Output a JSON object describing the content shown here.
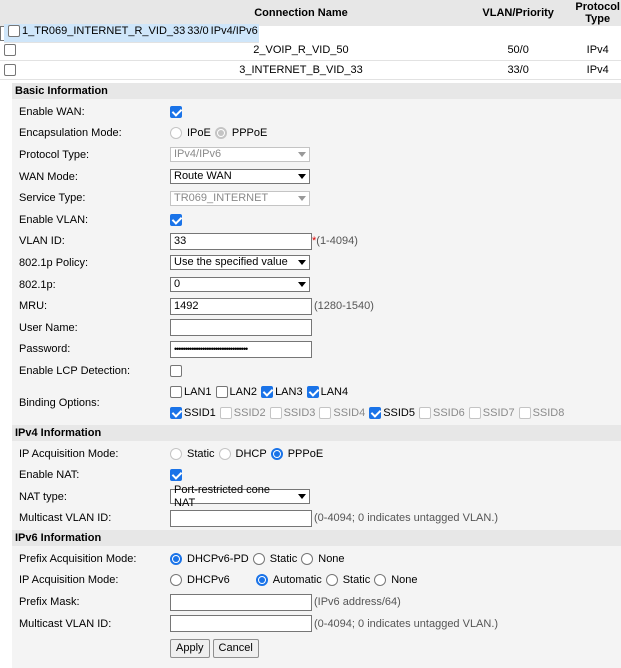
{
  "connections": {
    "headers": [
      "",
      "Connection Name",
      "VLAN/Priority",
      "Protocol Type"
    ],
    "rows": [
      {
        "name": "1_TR069_INTERNET_R_VID_33",
        "vlan": "33/0",
        "protocol": "IPv4/IPv6",
        "selected": true
      },
      {
        "name": "2_VOIP_R_VID_50",
        "vlan": "50/0",
        "protocol": "IPv4",
        "selected": false
      },
      {
        "name": "3_INTERNET_B_VID_33",
        "vlan": "33/0",
        "protocol": "IPv4",
        "selected": false
      }
    ]
  },
  "basic": {
    "title": "Basic Information",
    "enable_wan_label": "Enable WAN:",
    "encap_label": "Encapsulation Mode:",
    "encap_ipoe": "IPoE",
    "encap_pppoe": "PPPoE",
    "protocol_type_label": "Protocol Type:",
    "protocol_type_value": "IPv4/IPv6",
    "wan_mode_label": "WAN Mode:",
    "wan_mode_value": "Route WAN",
    "service_type_label": "Service Type:",
    "service_type_value": "TR069_INTERNET",
    "enable_vlan_label": "Enable VLAN:",
    "vlan_id_label": "VLAN ID:",
    "vlan_id_value": "33",
    "vlan_id_req": "*",
    "vlan_id_hint": "(1-4094)",
    "policy_label": "802.1p Policy:",
    "policy_value": "Use the specified value",
    "p_label": "802.1p:",
    "p_value": "0",
    "mru_label": "MRU:",
    "mru_value": "1492",
    "mru_hint": "(1280-1540)",
    "username_label": "User Name:",
    "username_value": "",
    "password_label": "Password:",
    "password_value": "••••••••••••••••••••••••••••••••••",
    "lcp_label": "Enable LCP Detection:",
    "binding_label": "Binding Options:",
    "lan": [
      {
        "label": "LAN1",
        "checked": false
      },
      {
        "label": "LAN2",
        "checked": false
      },
      {
        "label": "LAN3",
        "checked": true
      },
      {
        "label": "LAN4",
        "checked": true
      }
    ],
    "ssid": [
      {
        "label": "SSID1",
        "checked": true,
        "disabled": false
      },
      {
        "label": "SSID2",
        "checked": false,
        "disabled": true
      },
      {
        "label": "SSID3",
        "checked": false,
        "disabled": true
      },
      {
        "label": "SSID4",
        "checked": false,
        "disabled": true
      },
      {
        "label": "SSID5",
        "checked": true,
        "disabled": false
      },
      {
        "label": "SSID6",
        "checked": false,
        "disabled": true
      },
      {
        "label": "SSID7",
        "checked": false,
        "disabled": true
      },
      {
        "label": "SSID8",
        "checked": false,
        "disabled": true
      }
    ]
  },
  "ipv4": {
    "title": "IPv4 Information",
    "acq_label": "IP Acquisition Mode:",
    "acq_static": "Static",
    "acq_dhcp": "DHCP",
    "acq_pppoe": "PPPoE",
    "nat_label": "Enable NAT:",
    "nat_type_label": "NAT type:",
    "nat_type_value": "Port-restricted cone NAT",
    "mcast_label": "Multicast VLAN ID:",
    "mcast_value": "",
    "mcast_hint": "(0-4094; 0 indicates untagged VLAN.)"
  },
  "ipv6": {
    "title": "IPv6 Information",
    "prefix_acq_label": "Prefix Acquisition Mode:",
    "prefix_dhcpv6pd": "DHCPv6-PD",
    "prefix_static": "Static",
    "prefix_none": "None",
    "ip_acq_label": "IP Acquisition Mode:",
    "ip_dhcpv6": "DHCPv6",
    "ip_automatic": "Automatic",
    "ip_static": "Static",
    "ip_none": "None",
    "prefix_mask_label": "Prefix Mask:",
    "prefix_mask_value": "",
    "prefix_mask_hint": "(IPv6 address/64)",
    "mcast_label": "Multicast VLAN ID:",
    "mcast_value": "",
    "mcast_hint": "(0-4094; 0 indicates untagged VLAN.)"
  },
  "buttons": {
    "apply": "Apply",
    "cancel": "Cancel"
  },
  "colors": {
    "accent": "#1a73e8",
    "selected_row": "#cfe6fa",
    "section_header": "#e7e7e7",
    "form_bg": "#f4f4f4"
  }
}
